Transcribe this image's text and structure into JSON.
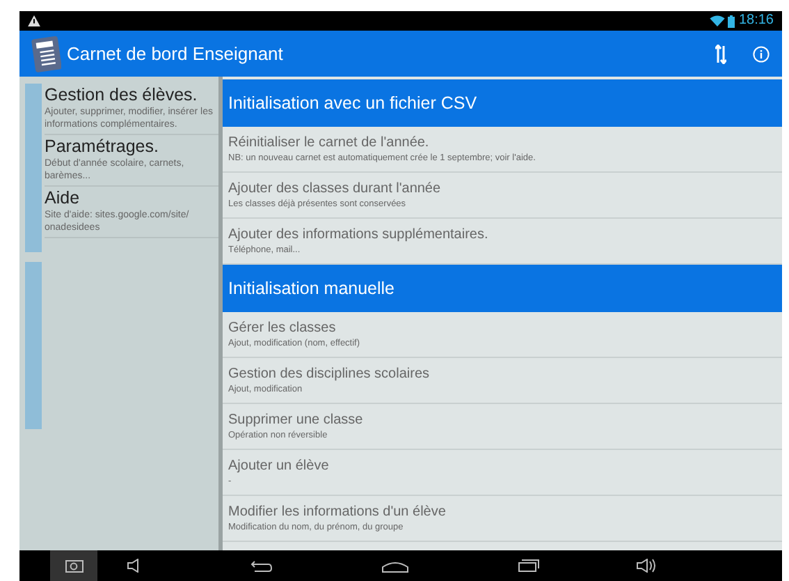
{
  "status_bar": {
    "time": "18:16"
  },
  "app_bar": {
    "title": "Carnet de bord Enseignant"
  },
  "drawer": {
    "items": [
      {
        "title": "Gestion des élèves.",
        "subtitle": "Ajouter, supprimer, modifier, insérer les informations complémentaires."
      },
      {
        "title": "Paramétrages.",
        "subtitle": "Début d'année scolaire, carnets, barèmes..."
      },
      {
        "title": "Aide",
        "subtitle": "Site d'aide: sites.google.com/site/ onadesidees"
      }
    ]
  },
  "sections": [
    {
      "title": "Initialisation avec un fichier CSV",
      "items": [
        {
          "title": "Réinitialiser le carnet de l'année.",
          "subtitle": "NB: un nouveau carnet est automatiquement crée le 1 septembre; voir l'aide."
        },
        {
          "title": "Ajouter des classes durant l'année",
          "subtitle": "Les classes déjà présentes sont conservées"
        },
        {
          "title": "Ajouter des informations supplémentaires.",
          "subtitle": "Téléphone, mail..."
        }
      ]
    },
    {
      "title": "Initialisation manuelle",
      "items": [
        {
          "title": "Gérer les classes",
          "subtitle": "Ajout, modification (nom, effectif)"
        },
        {
          "title": "Gestion des disciplines scolaires",
          "subtitle": "Ajout, modification"
        },
        {
          "title": "Supprimer une classe",
          "subtitle": "Opération non réversible"
        },
        {
          "title": "Ajouter un élève",
          "subtitle": "-"
        },
        {
          "title": "Modifier les informations d'un élève",
          "subtitle": "Modification du nom, du prénom, du groupe"
        }
      ]
    }
  ]
}
